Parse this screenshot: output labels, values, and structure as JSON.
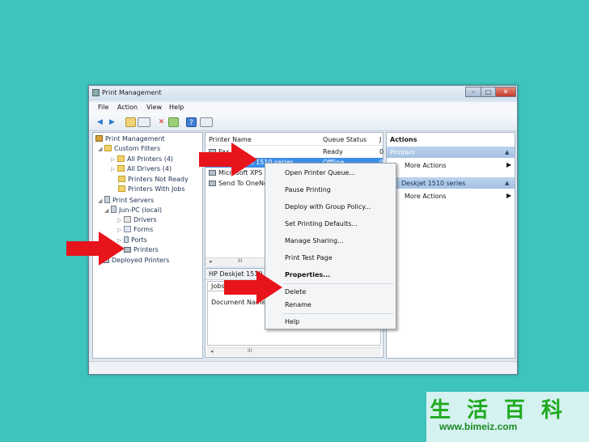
{
  "window": {
    "title": "Print Management",
    "controls": {
      "minimize": "–",
      "maximize": "□",
      "close": "✕"
    }
  },
  "menubar": [
    "File",
    "Action",
    "View",
    "Help"
  ],
  "toolbar": {
    "icons": [
      "back-icon",
      "forward-icon",
      "up-folder-icon",
      "show-hide-tree-icon",
      "delete-icon",
      "export-icon",
      "help-icon",
      "console-icon"
    ]
  },
  "tree": {
    "root": "Print Management",
    "custom_filters": "Custom Filters",
    "all_printers": "All Printers (4)",
    "all_drivers": "All Drivers (4)",
    "printers_not_ready": "Printers Not Ready",
    "printers_with_jobs": "Printers With Jobs",
    "print_servers": "Print Servers",
    "server": "Jun-PC (local)",
    "drivers": "Drivers",
    "forms": "Forms",
    "ports": "Ports",
    "printers": "Printers",
    "deployed_printers": "Deployed Printers"
  },
  "list": {
    "columns": [
      "Printer Name",
      "Queue Status",
      "J"
    ],
    "rows": [
      {
        "name": "Fax",
        "status": "Ready",
        "jobs": "0"
      },
      {
        "name": "HP Deskjet 1510 series",
        "status": "Offline",
        "jobs": "0"
      },
      {
        "name": "Microsoft XPS Document Writer",
        "status": "",
        "jobs": ""
      },
      {
        "name": "Send To OneNote",
        "status": "",
        "jobs": ""
      }
    ],
    "scroll_label": "III"
  },
  "details": {
    "header": "HP Deskjet 1510 series",
    "tab": "Jobs",
    "column": "Document Name",
    "scroll_label": "III"
  },
  "actions": {
    "header": "Actions",
    "sections": [
      {
        "title": "Printers",
        "item": "More Actions"
      },
      {
        "title": "Deskjet 1510 series",
        "item": "More Actions"
      }
    ]
  },
  "context_menu": {
    "items": [
      "Open Printer Queue...",
      "Pause Printing",
      "Deploy with Group Policy...",
      "Set Printing Defaults...",
      "Manage Sharing...",
      "Print Test Page",
      "Properties...",
      "Delete",
      "Rename",
      "Help"
    ]
  },
  "watermark": {
    "chars": [
      "生",
      "活",
      "百",
      "科"
    ],
    "url": "www.bimeiz.com"
  },
  "colors": {
    "background": "#3fc3bd",
    "selection": "#3f8ee6",
    "arrow": "#e8141b",
    "watermark": "#1faa1f"
  }
}
